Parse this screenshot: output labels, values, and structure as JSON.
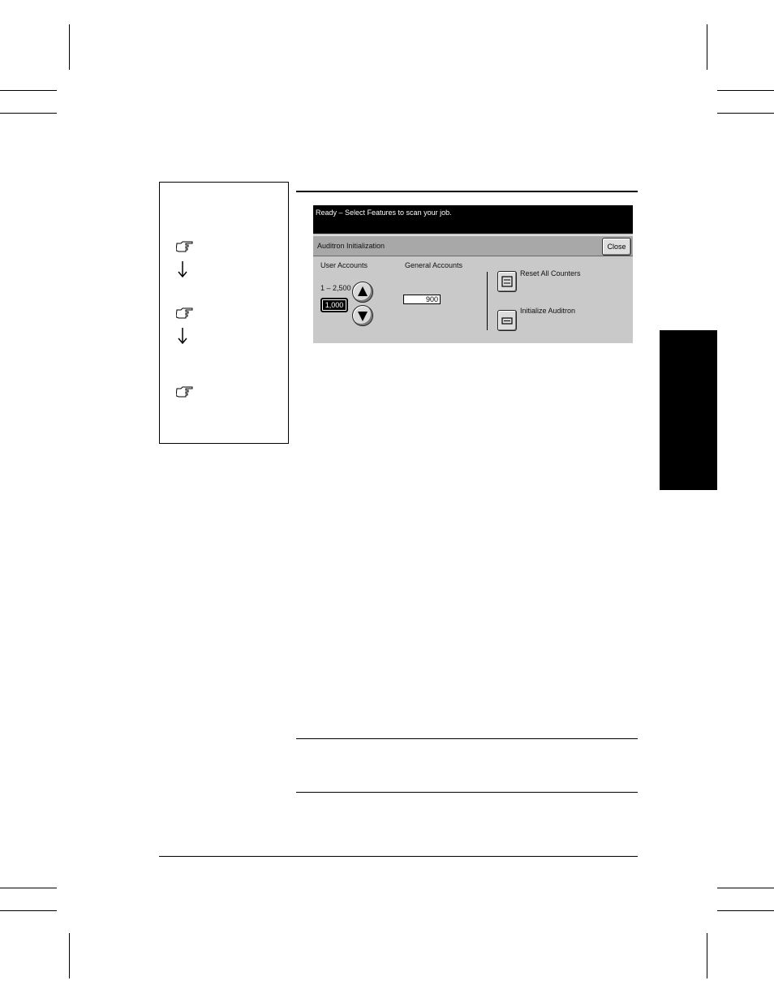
{
  "screen": {
    "message": "Ready –  Select Features to scan your job.",
    "title": "Auditron Initialization",
    "close_label": "Close",
    "user_accounts": {
      "label": "User Accounts",
      "range": "1 – 2,500",
      "value": "1,000"
    },
    "general_accounts": {
      "label": "General Accounts",
      "value": "900"
    },
    "reset_label": "Reset All Counters",
    "initialize_label": "Initialize Auditron"
  },
  "icons": {
    "step_marker": "pointing-hand-icon",
    "next": "arrow-down-icon",
    "up": "arrow-up-icon",
    "down": "arrow-down-icon"
  }
}
